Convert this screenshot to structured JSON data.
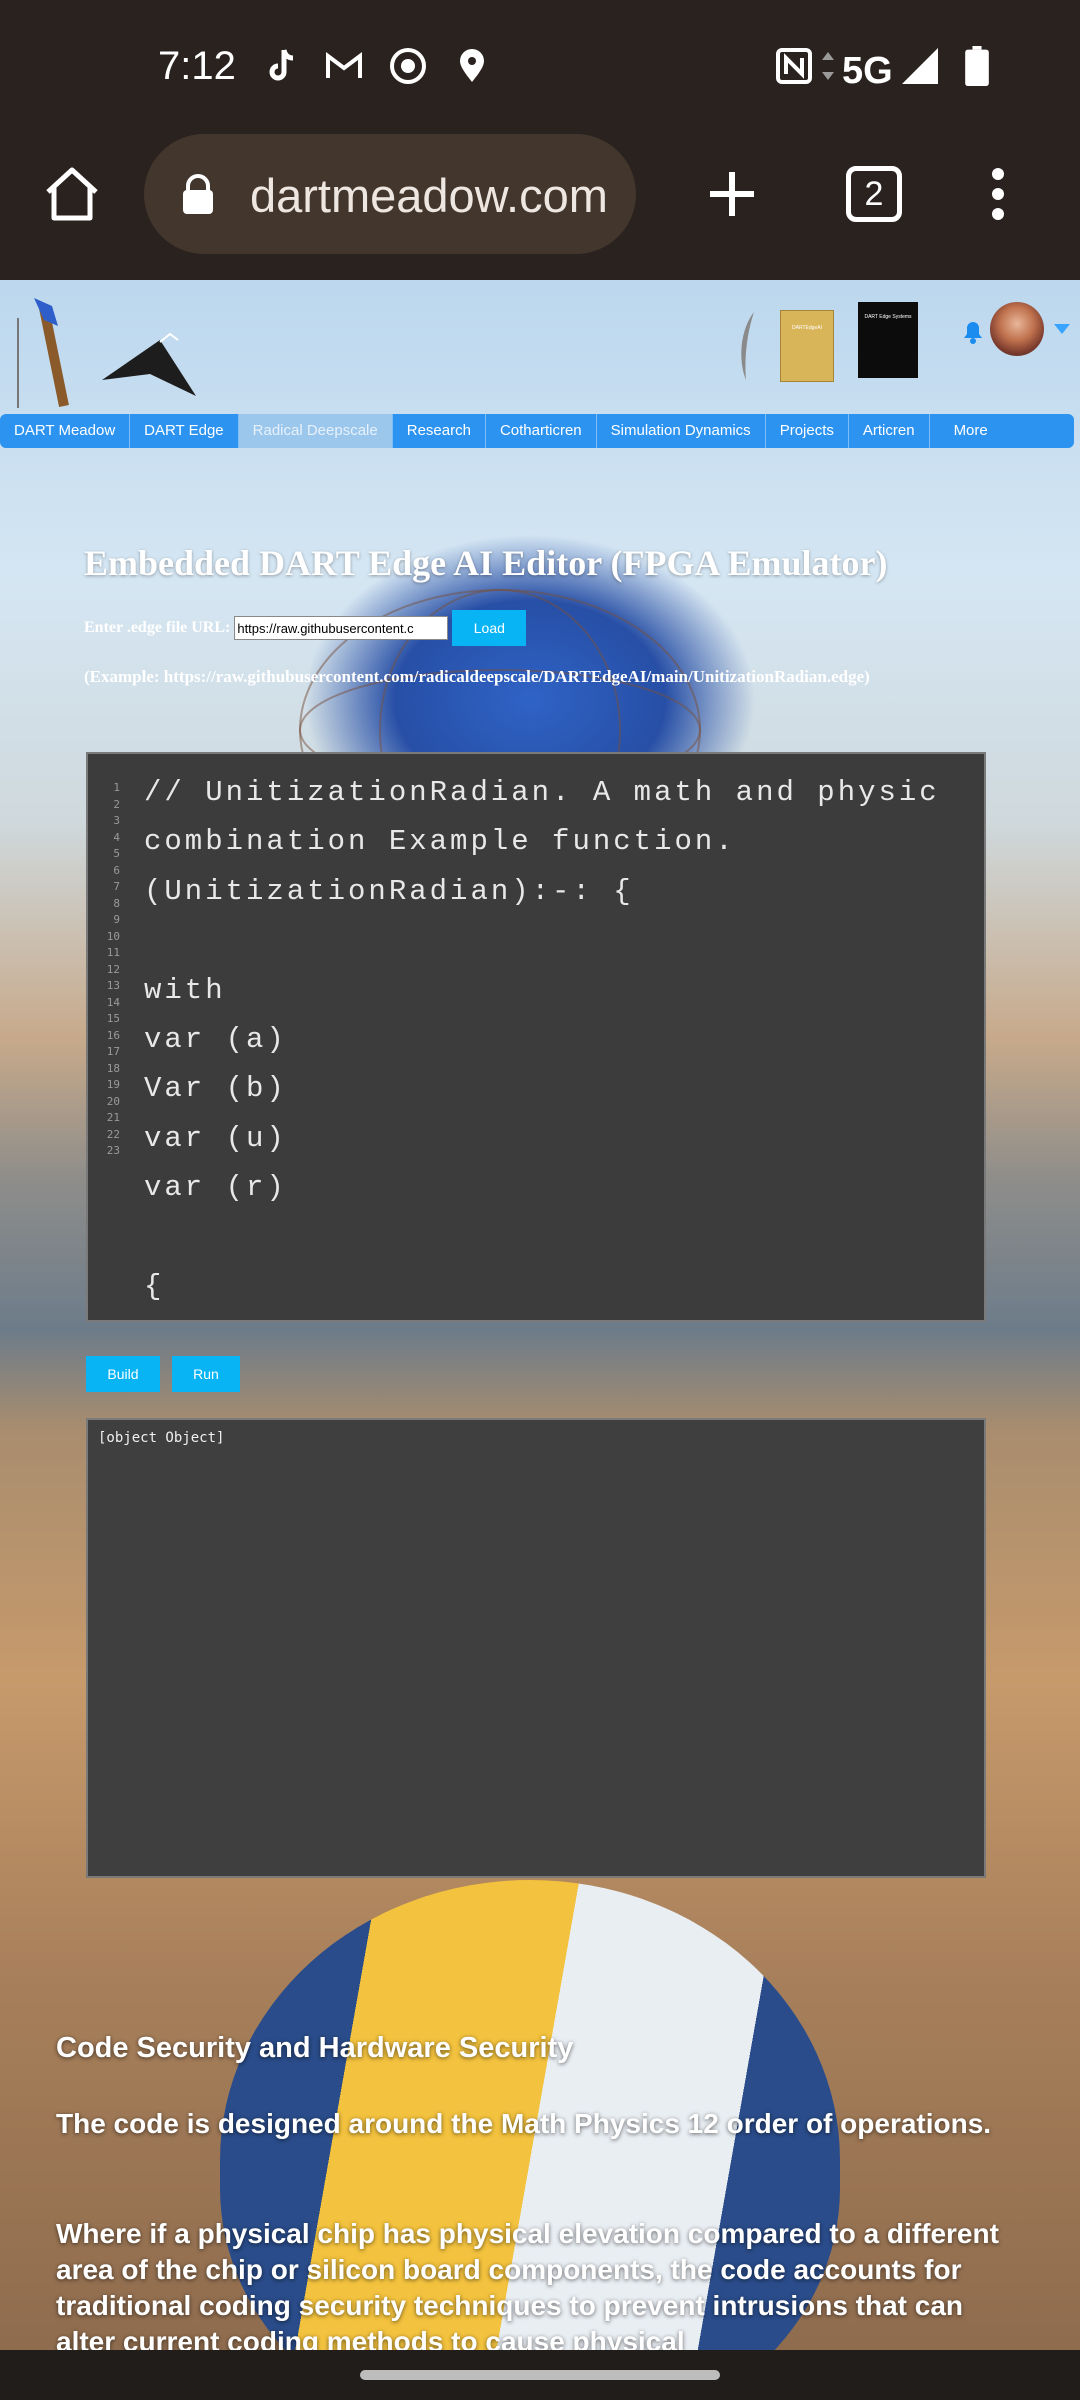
{
  "status_bar": {
    "time": "7:12",
    "network": "5G",
    "icons": [
      "tiktok-icon",
      "gmail-icon",
      "chrome-icon",
      "location-icon",
      "nfc-icon",
      "data-arrows-icon",
      "signal-icon",
      "battery-icon"
    ]
  },
  "browser": {
    "url_text": "dartmeadow.com",
    "tab_count": "2",
    "icons": [
      "home-icon",
      "lock-icon",
      "new-tab-plus-icon",
      "tabs-icon",
      "overflow-menu-icon"
    ]
  },
  "header": {
    "thumb2_text": "DARTEdgeAI",
    "thumb3_text": "DART Edge Systems"
  },
  "nav": {
    "items": [
      {
        "label": "DART Meadow"
      },
      {
        "label": "DART Edge"
      },
      {
        "label": "Radical Deepscale"
      },
      {
        "label": "Research"
      },
      {
        "label": "Cotharticren"
      },
      {
        "label": "Simulation Dynamics"
      },
      {
        "label": "Projects"
      },
      {
        "label": "Articren"
      },
      {
        "label": "More"
      }
    ],
    "active_index": 2,
    "accent": "#2d93f0"
  },
  "main": {
    "title": "Embedded DART Edge AI Editor (FPGA Emulator)",
    "url_label": "Enter .edge file URL:",
    "url_value": "https://raw.githubusercontent.c",
    "load_label": "Load",
    "example_text": "(Example: https://raw.githubusercontent.com/radicaldeepscale/DARTEdgeAI/main/UnitizationRadian.edge)"
  },
  "editor": {
    "line_numbers": "1\n2\n3\n4\n5\n6\n7\n8\n9\n10\n11\n12\n13\n14\n15\n16\n17\n18\n19\n20\n21\n22\n23",
    "code": "// UnitizationRadian. A math and physic combination Example function.\n(UnitizationRadian):-: {\n\nwith\nvar (a)\nVar (b)\nvar (u)\nvar (r)\n\n{"
  },
  "actions": {
    "build_label": "Build",
    "run_label": "Run",
    "button_color": "#09b4f5"
  },
  "output": {
    "text": "[object Object]"
  },
  "security": {
    "title": "Code Security and Hardware Security",
    "p1": "The code is designed around the Math Physics 12 order of operations.",
    "p2": "Where if a physical chip has physical elevation compared to a different area of the chip or silicon board components, the code accounts for traditional coding security techniques to prevent intrusions that can alter current coding methods to cause physical"
  }
}
